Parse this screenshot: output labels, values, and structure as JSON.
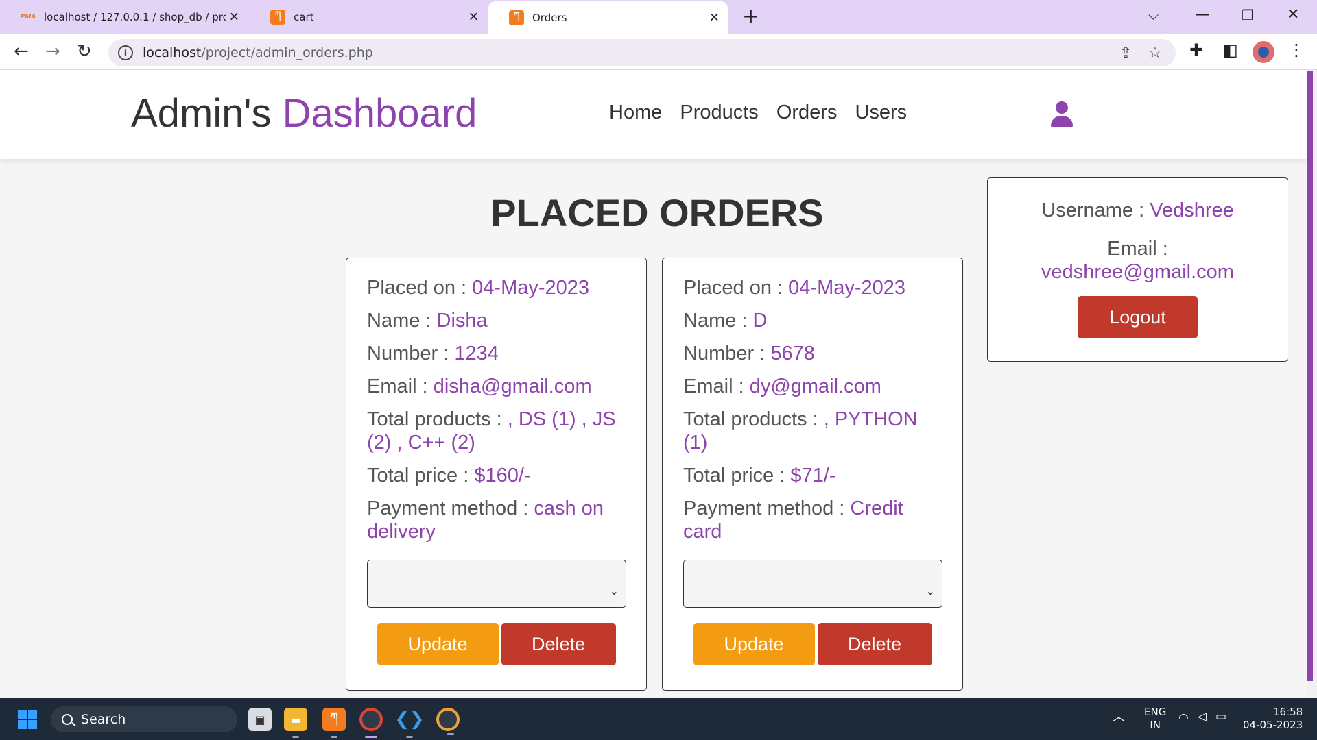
{
  "browser": {
    "tabs": [
      {
        "title": "localhost / 127.0.0.1 / shop_db / produc",
        "icon": "phpmyadmin-icon",
        "active": false
      },
      {
        "title": "cart",
        "icon": "xampp-icon",
        "active": false
      },
      {
        "title": "Orders",
        "icon": "xampp-icon",
        "active": true
      }
    ],
    "url_host": "localhost",
    "url_path": "/project/admin_orders.php"
  },
  "header": {
    "logo_main": "Admin's",
    "logo_accent": "Dashboard",
    "nav": [
      "Home",
      "Products",
      "Orders",
      "Users"
    ]
  },
  "account": {
    "username_label": "Username : ",
    "username": "Vedshree",
    "email_label": "Email :",
    "email": "vedshree@gmail.com",
    "logout_label": "Logout"
  },
  "heading": "PLACED ORDERS",
  "orders": [
    {
      "placed_label": "Placed on : ",
      "placed_on": "04-May-2023",
      "name_label": "Name : ",
      "name": "Disha",
      "number_label": "Number : ",
      "number": "1234",
      "email_label": "Email : ",
      "email": "disha@gmail.com",
      "products_label": "Total products : ",
      "products": ", DS (1) , JS (2) , C++ (2)",
      "price_label": "Total price : ",
      "price": "$160/-",
      "method_label": "Payment method : ",
      "method": "cash on delivery",
      "update_label": "Update",
      "delete_label": "Delete"
    },
    {
      "placed_label": "Placed on : ",
      "placed_on": "04-May-2023",
      "name_label": "Name : ",
      "name": "D",
      "number_label": "Number : ",
      "number": "5678",
      "email_label": "Email : ",
      "email": "dy@gmail.com",
      "products_label": "Total products : ",
      "products": ", PYTHON (1)",
      "price_label": "Total price : ",
      "price": "$71/-",
      "method_label": "Payment method : ",
      "method": "Credit card",
      "update_label": "Update",
      "delete_label": "Delete"
    }
  ],
  "taskbar": {
    "search_label": "Search",
    "lang_top": "ENG",
    "lang_bottom": "IN",
    "time": "16:58",
    "date": "04-05-2023"
  },
  "colors": {
    "accent": "#8e44ad",
    "update": "#f39c12",
    "danger": "#c0392b",
    "tabbar": "#e3d3f7"
  }
}
